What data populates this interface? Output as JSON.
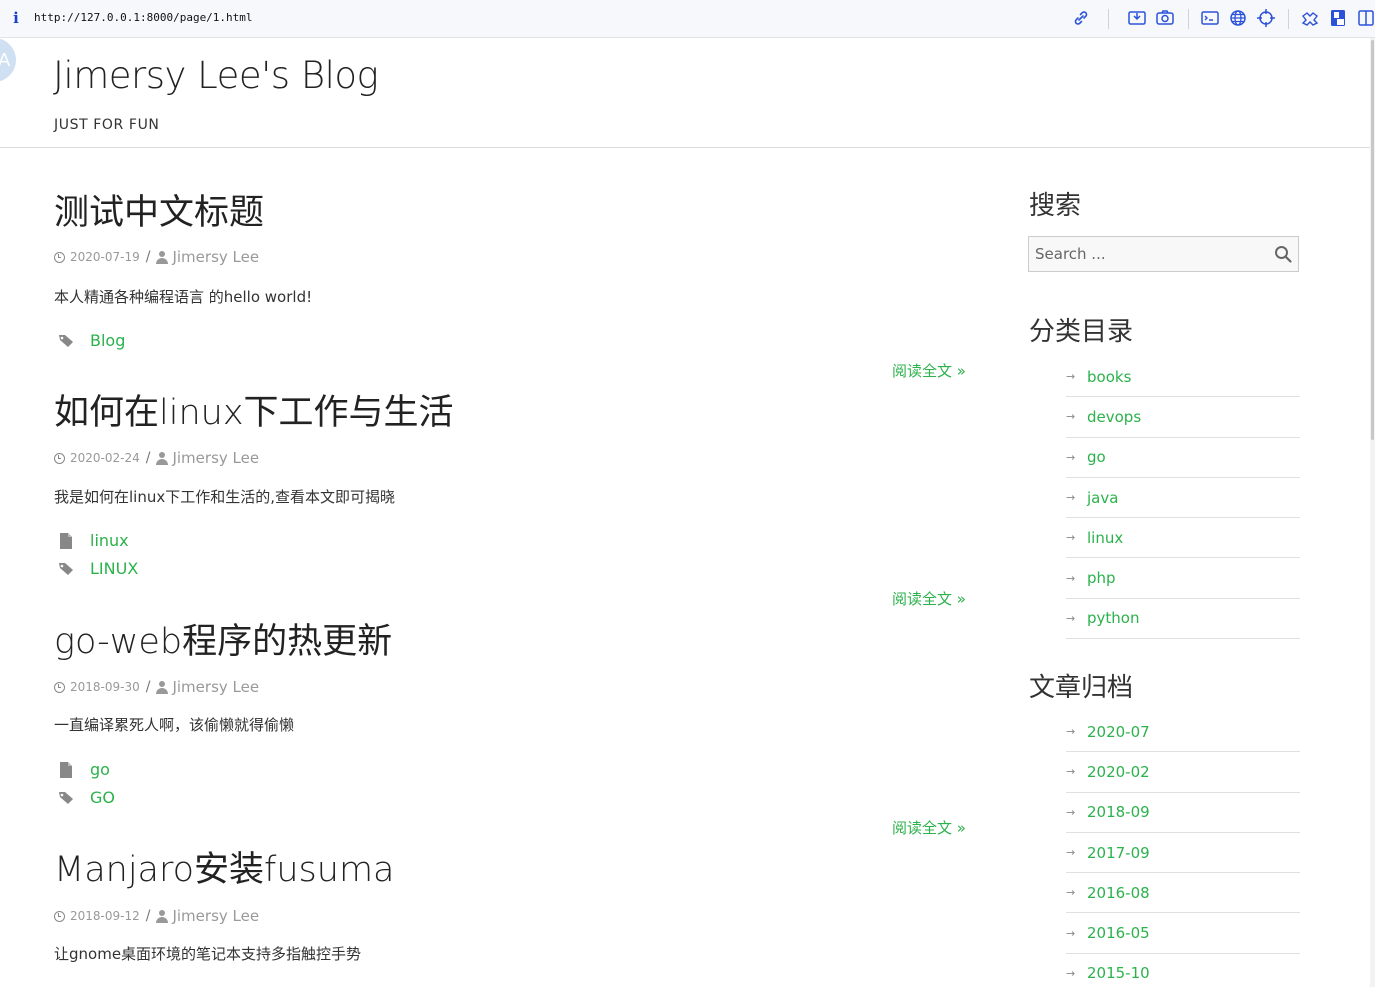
{
  "browser": {
    "url": "http://127.0.0.1:8000/page/1.html",
    "toolbar_icons": [
      "link-icon",
      "save-page-icon",
      "screenshot-icon",
      "terminal-icon",
      "globe-icon",
      "crosshair-icon",
      "extensions-icon",
      "bookmark-icon",
      "sidebar-icon"
    ]
  },
  "site": {
    "title": "Jimersy Lee's Blog",
    "subtitle": "JUST FOR FUN"
  },
  "articles": [
    {
      "title": "测试中文标题",
      "date": "2020-07-19",
      "author": "Jimersy Lee",
      "summary": "本人精通各种编程语言 的hello world!",
      "category": "",
      "tag": "Blog",
      "read_more": "阅读全文 »"
    },
    {
      "title": "如何在linux下工作与生活",
      "date": "2020-02-24",
      "author": "Jimersy Lee",
      "summary": "我是如何在linux下工作和生活的,查看本文即可揭晓",
      "category": "linux",
      "tag": "LINUX",
      "read_more": "阅读全文 »"
    },
    {
      "title": "go-web程序的热更新",
      "date": "2018-09-30",
      "author": "Jimersy Lee",
      "summary": "一直编译累死人啊，该偷懒就得偷懒",
      "category": "go",
      "tag": "GO",
      "read_more": "阅读全文 »"
    },
    {
      "title": "Manjaro安装fusuma",
      "date": "2018-09-12",
      "author": "Jimersy Lee",
      "summary": "让gnome桌面环境的笔记本支持多指触控手势"
    }
  ],
  "sidebar": {
    "search_title": "搜索",
    "search_placeholder": "Search ...",
    "categories_title": "分类目录",
    "categories": [
      "books",
      "devops",
      "go",
      "java",
      "linux",
      "php",
      "python"
    ],
    "archives_title": "文章归档",
    "archives": [
      "2020-07",
      "2020-02",
      "2018-09",
      "2017-09",
      "2016-08",
      "2016-05",
      "2015-10"
    ],
    "list_arrow": "→"
  },
  "colors": {
    "link_green": "#2bb24c",
    "meta_gray": "#999999"
  }
}
